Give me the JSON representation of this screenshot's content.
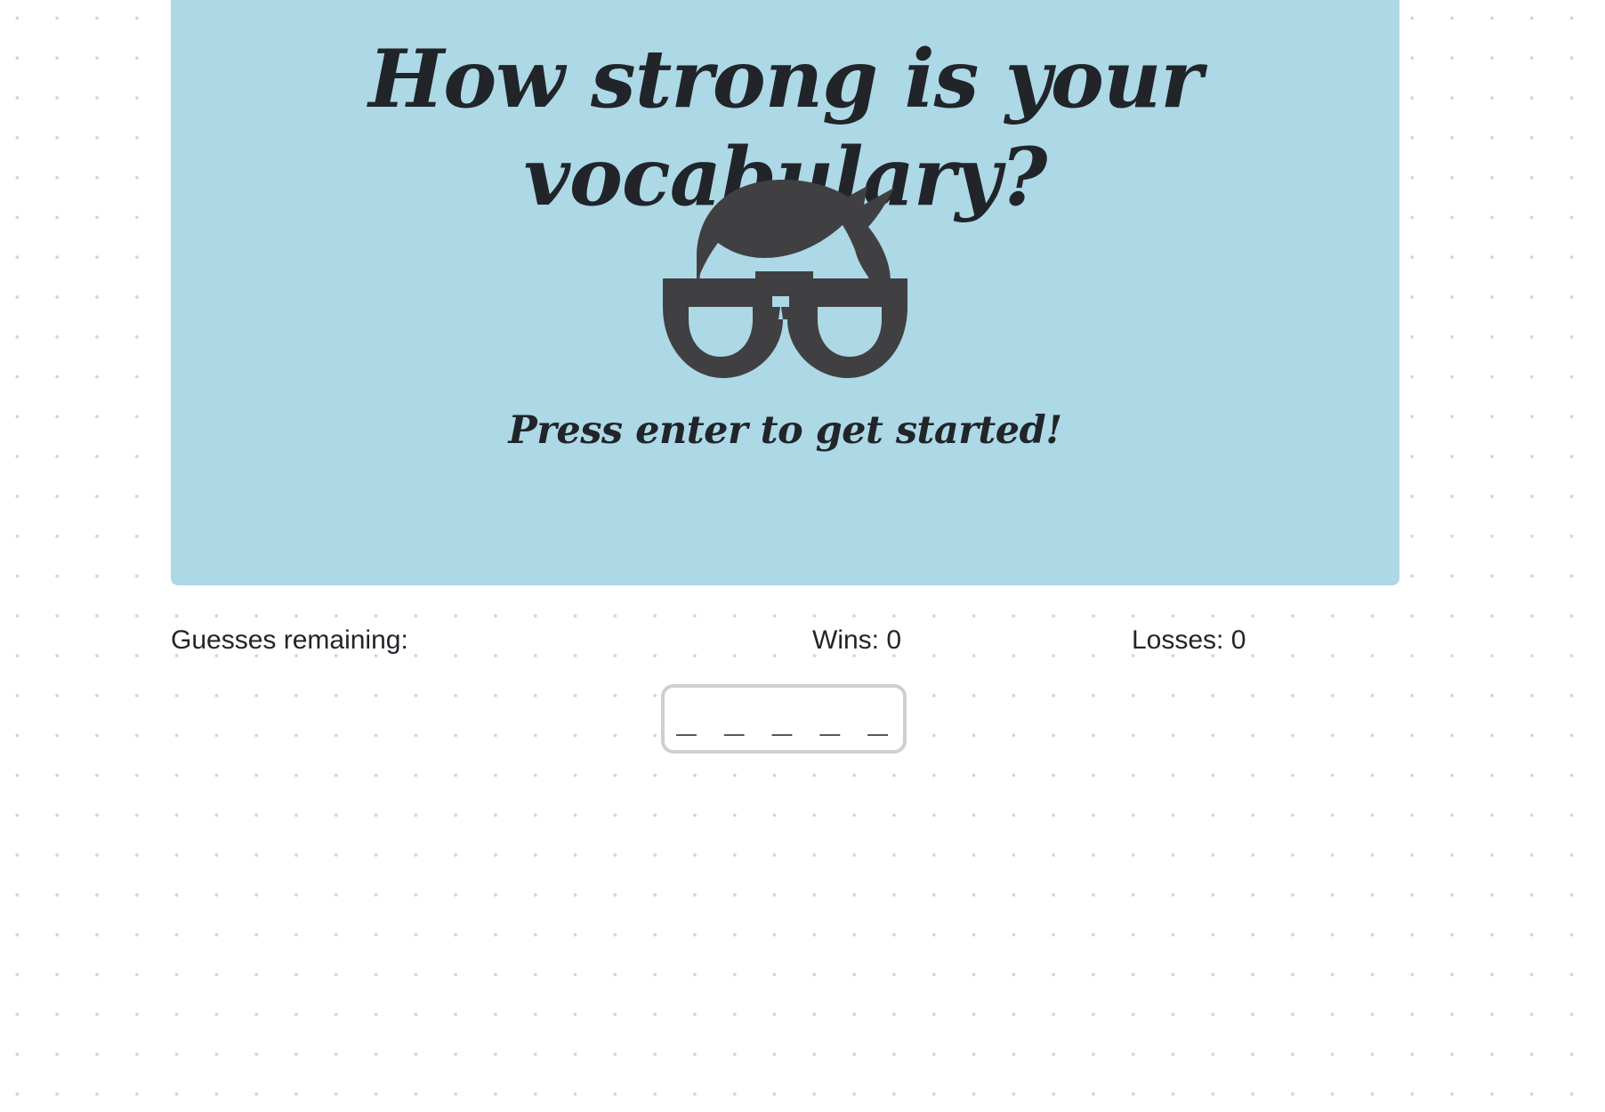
{
  "hero": {
    "title": "How strong is your vocabulary?",
    "prompt": "Press enter to get started!",
    "background_color": "#add8e6",
    "icon": "geek-glasses-icon",
    "icon_color": "#404043"
  },
  "stats": {
    "guesses_label": "Guesses remaining:",
    "wins_label": "Wins: 0",
    "losses_label": "Losses: 0"
  },
  "word": {
    "display": "_ _ _ _ _"
  }
}
